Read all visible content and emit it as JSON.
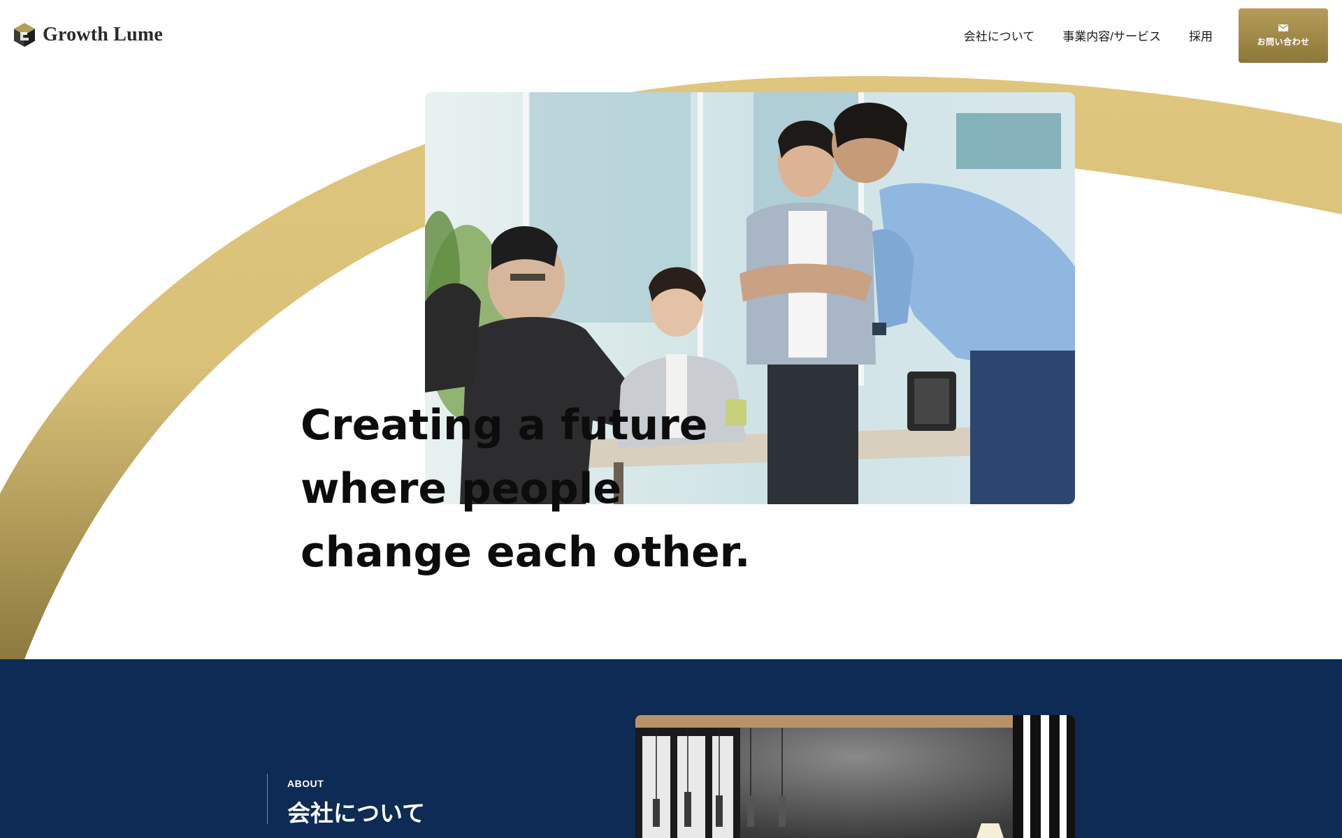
{
  "brand": {
    "name": "Growth Lume",
    "accent": "#c2a660",
    "navy": "#0d2b54"
  },
  "nav": {
    "items": [
      {
        "label": "会社について"
      },
      {
        "label": "事業内容/サービス"
      },
      {
        "label": "採用"
      }
    ],
    "contact_label": "お問い合わせ",
    "contact_icon": "mail-icon"
  },
  "hero": {
    "tagline": [
      "Creating a future",
      "where people",
      "change each other."
    ],
    "photo_alt": "team-meeting-photo"
  },
  "about": {
    "eyebrow": "ABOUT",
    "title": "会社について",
    "photo_alt": "office-interior-photo"
  }
}
